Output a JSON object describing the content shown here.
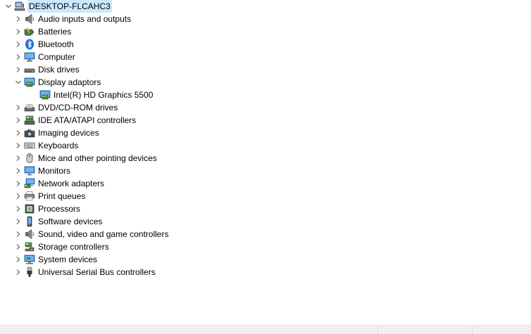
{
  "tree": {
    "root_label": "DESKTOP-FLCAHC3",
    "categories": [
      {
        "label": "Audio inputs and outputs",
        "icon": "speaker-icon",
        "expanded": false
      },
      {
        "label": "Batteries",
        "icon": "battery-icon",
        "expanded": false
      },
      {
        "label": "Bluetooth",
        "icon": "bluetooth-icon",
        "expanded": false
      },
      {
        "label": "Computer",
        "icon": "computer-icon",
        "expanded": false
      },
      {
        "label": "Disk drives",
        "icon": "disk-drive-icon",
        "expanded": false
      },
      {
        "label": "Display adaptors",
        "icon": "display-adapter-icon",
        "expanded": true,
        "children": [
          {
            "label": "Intel(R) HD Graphics 5500",
            "icon": "display-adapter-icon"
          }
        ]
      },
      {
        "label": "DVD/CD-ROM drives",
        "icon": "dvd-drive-icon",
        "expanded": false
      },
      {
        "label": "IDE ATA/ATAPI controllers",
        "icon": "ide-controller-icon",
        "expanded": false
      },
      {
        "label": "Imaging devices",
        "icon": "camera-icon",
        "expanded": false
      },
      {
        "label": "Keyboards",
        "icon": "keyboard-icon",
        "expanded": false
      },
      {
        "label": "Mice and other pointing devices",
        "icon": "mouse-icon",
        "expanded": false
      },
      {
        "label": "Monitors",
        "icon": "monitor-icon",
        "expanded": false
      },
      {
        "label": "Network adapters",
        "icon": "network-adapter-icon",
        "expanded": false
      },
      {
        "label": "Print queues",
        "icon": "printer-icon",
        "expanded": false
      },
      {
        "label": "Processors",
        "icon": "processor-icon",
        "expanded": false
      },
      {
        "label": "Software devices",
        "icon": "software-device-icon",
        "expanded": false
      },
      {
        "label": "Sound, video and game controllers",
        "icon": "speaker-icon",
        "expanded": false
      },
      {
        "label": "Storage controllers",
        "icon": "storage-controller-icon",
        "expanded": false
      },
      {
        "label": "System devices",
        "icon": "system-device-icon",
        "expanded": false
      },
      {
        "label": "Universal Serial Bus controllers",
        "icon": "usb-icon",
        "expanded": false
      }
    ]
  },
  "colors": {
    "selection": "#cce8ff",
    "chevron": "#555555",
    "statusbar": "#f0f0f0"
  }
}
